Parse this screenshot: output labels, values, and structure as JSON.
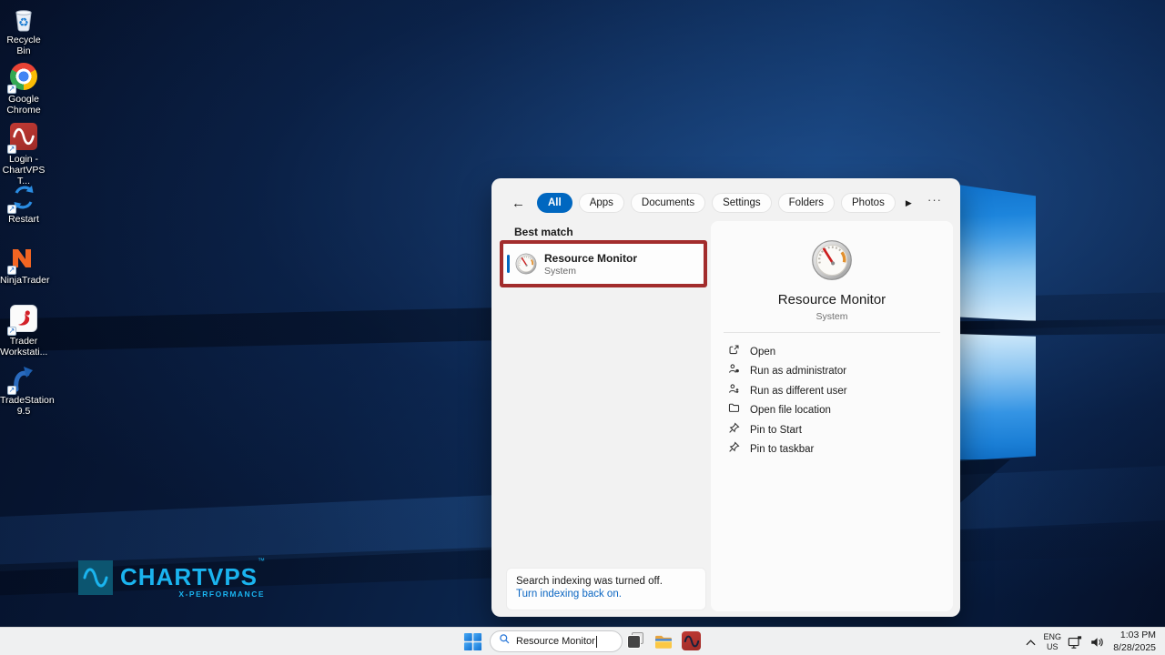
{
  "desktop": {
    "icons": [
      {
        "label": "Recycle Bin",
        "icon": "recycle-bin"
      },
      {
        "label": "Google Chrome",
        "icon": "chrome"
      },
      {
        "label": "Login - ChartVPS T...",
        "icon": "chartvps-login"
      },
      {
        "label": "Restart",
        "icon": "restart"
      },
      {
        "label": "NinjaTrader",
        "icon": "ninjatrader"
      },
      {
        "label": "Trader Workstati...",
        "icon": "trader-workstation"
      },
      {
        "label": "TradeStation 9.5",
        "icon": "tradestation"
      }
    ],
    "brand": {
      "name": "CHARTVPS",
      "tm": "™",
      "subtitle": "X-PERFORMANCE",
      "color": "#1ab4ef"
    }
  },
  "search_panel": {
    "back_icon": "←",
    "more_tabs_icon": "▶",
    "more_options_icon": "···",
    "tabs": [
      {
        "label": "All",
        "active": true
      },
      {
        "label": "Apps"
      },
      {
        "label": "Documents"
      },
      {
        "label": "Settings"
      },
      {
        "label": "Folders"
      },
      {
        "label": "Photos"
      }
    ],
    "section_label": "Best match",
    "best_match": {
      "title": "Resource Monitor",
      "subtitle": "System"
    },
    "details": {
      "title": "Resource Monitor",
      "subtitle": "System",
      "actions": [
        {
          "label": "Open",
          "icon": "open-icon"
        },
        {
          "label": "Run as administrator",
          "icon": "run-as-admin-icon"
        },
        {
          "label": "Run as different user",
          "icon": "run-as-user-icon"
        },
        {
          "label": "Open file location",
          "icon": "folder-icon"
        },
        {
          "label": "Pin to Start",
          "icon": "pin-icon"
        },
        {
          "label": "Pin to taskbar",
          "icon": "pin-icon"
        }
      ]
    },
    "notice": {
      "text": "Search indexing was turned off.",
      "link": "Turn indexing back on."
    }
  },
  "taskbar": {
    "search": {
      "value": "Resource Monitor"
    },
    "tray": {
      "lang1": "ENG",
      "lang2": "US",
      "time": "1:03 PM",
      "date": "8/28/2025"
    }
  },
  "colors": {
    "accent": "#0067c0",
    "annotation_red": "#a22c2c",
    "link_blue": "#0b66c2"
  }
}
